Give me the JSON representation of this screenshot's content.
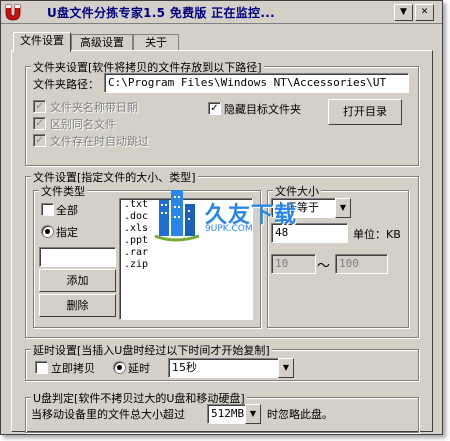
{
  "window": {
    "title": "U盘文件分拣专家1.5 免费版   正在监控...",
    "close_glyph": "✕",
    "menu_glyph": "▼"
  },
  "tabs": [
    {
      "label": "文件设置",
      "active": true
    },
    {
      "label": "高级设置",
      "active": false
    },
    {
      "label": "关于",
      "active": false
    }
  ],
  "folder_settings": {
    "legend": "文件夹设置[软件将拷贝的文件存放到以下路径]",
    "path_label": "文件夹路径：",
    "path_value": "C:\\Program Files\\Windows NT\\Accessories\\UT",
    "hide_target_label": "隐藏目标文件夹",
    "hide_target_checked": true,
    "open_dir_button": "打开目录",
    "disabled_options": [
      {
        "label": "文件夹名称带日期",
        "checked": true
      },
      {
        "label": "区别同名文件",
        "checked": true
      },
      {
        "label": "文件存在时自动跳过",
        "checked": true
      }
    ]
  },
  "file_settings": {
    "legend": "文件设置[指定文件的大小、类型]",
    "type_legend": "文件类型",
    "all_label": "全部",
    "specify_label": "指定",
    "add_button": "添加",
    "delete_button": "删除",
    "extensions": [
      ".txt",
      ".doc",
      ".xls",
      ".ppt",
      ".rar",
      ".zip"
    ],
    "size_legend": "文件大小",
    "size_condition": "小于等于",
    "size_value": "48",
    "unit_label": "单位：KB",
    "range_from": "10",
    "range_to": "100",
    "range_sep": "～"
  },
  "delay_settings": {
    "legend": "延时设置[当插入U盘时经过以下时间才开始复制]",
    "immediate_label": "立即拷贝",
    "delay_label": "延时",
    "delay_value": "15秒"
  },
  "udisk_settings": {
    "legend": "U盘判定[软件不拷贝过大的U盘和移动硬盘]",
    "text_before": "当移动设备里的文件总大小超过",
    "size_value": "512MB",
    "text_after": "时忽略此盘。"
  },
  "watermark": {
    "title": "久友下载",
    "url": "9UPK.COM"
  },
  "colors": {
    "face": "#d4d0c8",
    "title_text": "#000080",
    "logo_red": "#cc1111"
  }
}
